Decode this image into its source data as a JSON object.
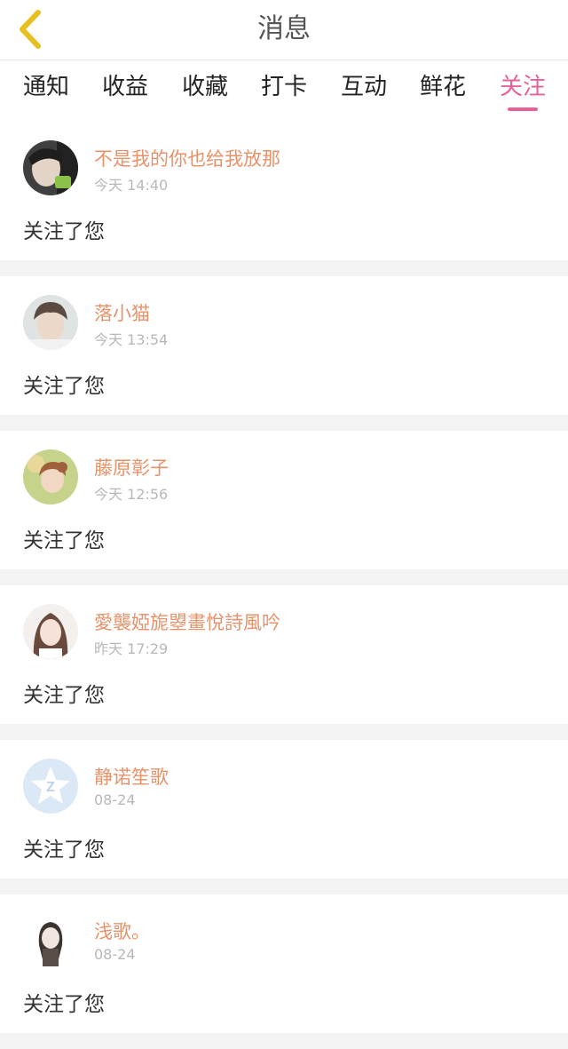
{
  "header": {
    "title": "消息",
    "back_icon": "chevron-left-icon",
    "back_color": "#e6c020"
  },
  "tabs": [
    {
      "label": "通知",
      "active": false
    },
    {
      "label": "收益",
      "active": false
    },
    {
      "label": "收藏",
      "active": false
    },
    {
      "label": "打卡",
      "active": false
    },
    {
      "label": "互动",
      "active": false
    },
    {
      "label": "鲜花",
      "active": false
    },
    {
      "label": "关注",
      "active": true
    }
  ],
  "accent_color": "#e8609a",
  "name_color": "#e8926a",
  "notifications": [
    {
      "name": "不是我的你也给我放那",
      "time": "今天 14:40",
      "message": "关注了您"
    },
    {
      "name": "落小猫",
      "time": "今天 13:54",
      "message": "关注了您"
    },
    {
      "name": "藤原彰子",
      "time": "今天 12:56",
      "message": "关注了您"
    },
    {
      "name": "愛襲婭旎曌畫悅詩風吟",
      "time": "昨天 17:29",
      "message": "关注了您"
    },
    {
      "name": "静诺笙歌",
      "time": "08-24",
      "message": "关注了您"
    },
    {
      "name": "浅歌。",
      "time": "08-24",
      "message": "关注了您"
    }
  ]
}
